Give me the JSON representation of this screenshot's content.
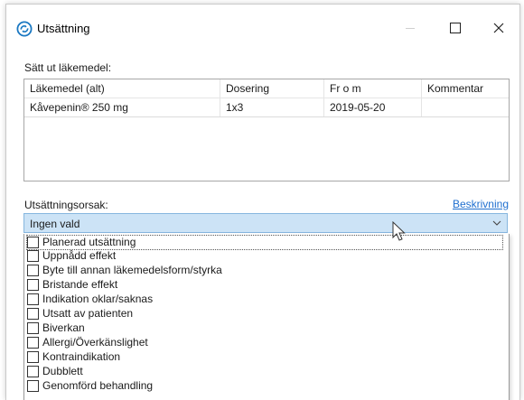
{
  "window": {
    "title": "Utsättning"
  },
  "medication_section": {
    "label": "Sätt ut läkemedel:",
    "columns": [
      "Läkemedel (alt)",
      "Dosering",
      "Fr o m",
      "Kommentar"
    ],
    "rows": [
      [
        "Kåvepenin® 250 mg",
        "1x3",
        "2019-05-20",
        ""
      ]
    ]
  },
  "reason_section": {
    "label": "Utsättningsorsak:",
    "description_link": "Beskrivning",
    "selected": "Ingen vald",
    "options": [
      "Planerad utsättning",
      "Uppnådd effekt",
      "Byte till annan läkemedelsform/styrka",
      "Bristande effekt",
      "Indikation oklar/saknas",
      "Utsatt av patienten",
      "Biverkan",
      "Allergi/Överkänslighet",
      "Kontraindikation",
      "Dubblett",
      "Genomförd behandling"
    ]
  },
  "colors": {
    "link": "#1f6fcf",
    "combo_selected": "#cce3f6",
    "icon": "#1a78c2"
  },
  "icons": {
    "app": "refresh-circle-icon",
    "minimize": "minimize-icon",
    "maximize": "maximize-icon",
    "close": "close-icon",
    "dropdown": "chevron-down-icon",
    "cursor": "mouse-pointer-icon"
  }
}
